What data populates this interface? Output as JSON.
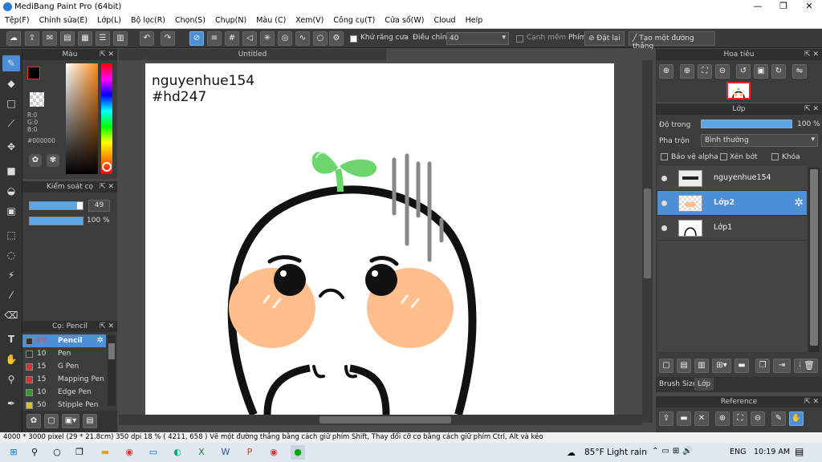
{
  "app": {
    "title": "MediBang Paint Pro (64bit)",
    "window_buttons": [
      "—",
      "❐",
      "✕"
    ]
  },
  "menu": [
    "Tệp(F)",
    "Chỉnh sửa(E)",
    "Lớp(L)",
    "Bộ lọc(R)",
    "Chọn(S)",
    "Chụp(N)",
    "Màu (C)",
    "Xem(V)",
    "Công cụ(T)",
    "Cửa sổ(W)",
    "Cloud",
    "Help"
  ],
  "toolbar": {
    "antialias_label": "Khử răng cưa",
    "adjust_label": "Điều chỉnh",
    "adjust_value": "40",
    "sharp_label": "Cạnh mềm",
    "key_label": "Phím",
    "reset_label": "Đặt lại",
    "line_label": "Tạo một đường thẳng"
  },
  "color_panel": {
    "title": "Màu",
    "r": "R:0",
    "g": "G:0",
    "b": "B:0",
    "hex": "#000000"
  },
  "brush_control": {
    "title": "Kiểm soát cọ",
    "size": "49",
    "opacity": "100 %",
    "size_fraction": 0.9,
    "opacity_fraction": 1.0
  },
  "brush_panel": {
    "title": "Cọ: Pencil",
    "items": [
      {
        "size": "49",
        "name": "Pencil",
        "color": "#333333"
      },
      {
        "size": "10",
        "name": "Pen",
        "color": "#333333"
      },
      {
        "size": "15",
        "name": "G Pen",
        "color": "#d93030"
      },
      {
        "size": "15",
        "name": "Mapping Pen",
        "color": "#d93030"
      },
      {
        "size": "10",
        "name": "Edge Pen",
        "color": "#2aa02a"
      },
      {
        "size": "50",
        "name": "Stipple Pen",
        "color": "#d9c030"
      }
    ]
  },
  "canvas": {
    "tab": "Untitled",
    "text_line1": "nguyenhue154",
    "text_line2": "#hd247"
  },
  "navigator": {
    "title": "Hoa tiêu"
  },
  "layer_panel": {
    "title": "Lớp",
    "opacity_label": "Độ trong",
    "opacity_value": "100 %",
    "blend_label": "Pha trộn",
    "blend_value": "Bình thường",
    "protect_alpha": "Bảo vệ alpha",
    "clip": "Xén bớt",
    "lock": "Khóa",
    "layers": [
      "nguyenhue154",
      "Lớp2",
      "Lớp1"
    ],
    "tabs": [
      "Brush Size",
      "Lớp"
    ]
  },
  "reference": {
    "title": "Reference"
  },
  "status": {
    "text": "4000 * 3000 pixel   (29 * 21.8cm)   350 dpi   18 %   ( 4211, 658 )   Vẽ một đường thẳng bằng cách giữ phím Shift, Thay đổi cỡ cọ bằng cách giữ phím Ctrl, Alt và kéo"
  },
  "taskbar": {
    "weather": "85°F  Light rain",
    "lang": "ENG",
    "time": "10:19 AM"
  },
  "colors": {
    "accent": "#4d8fd6",
    "sprout": "#6cd66c",
    "blush": "#ffbe8c"
  }
}
